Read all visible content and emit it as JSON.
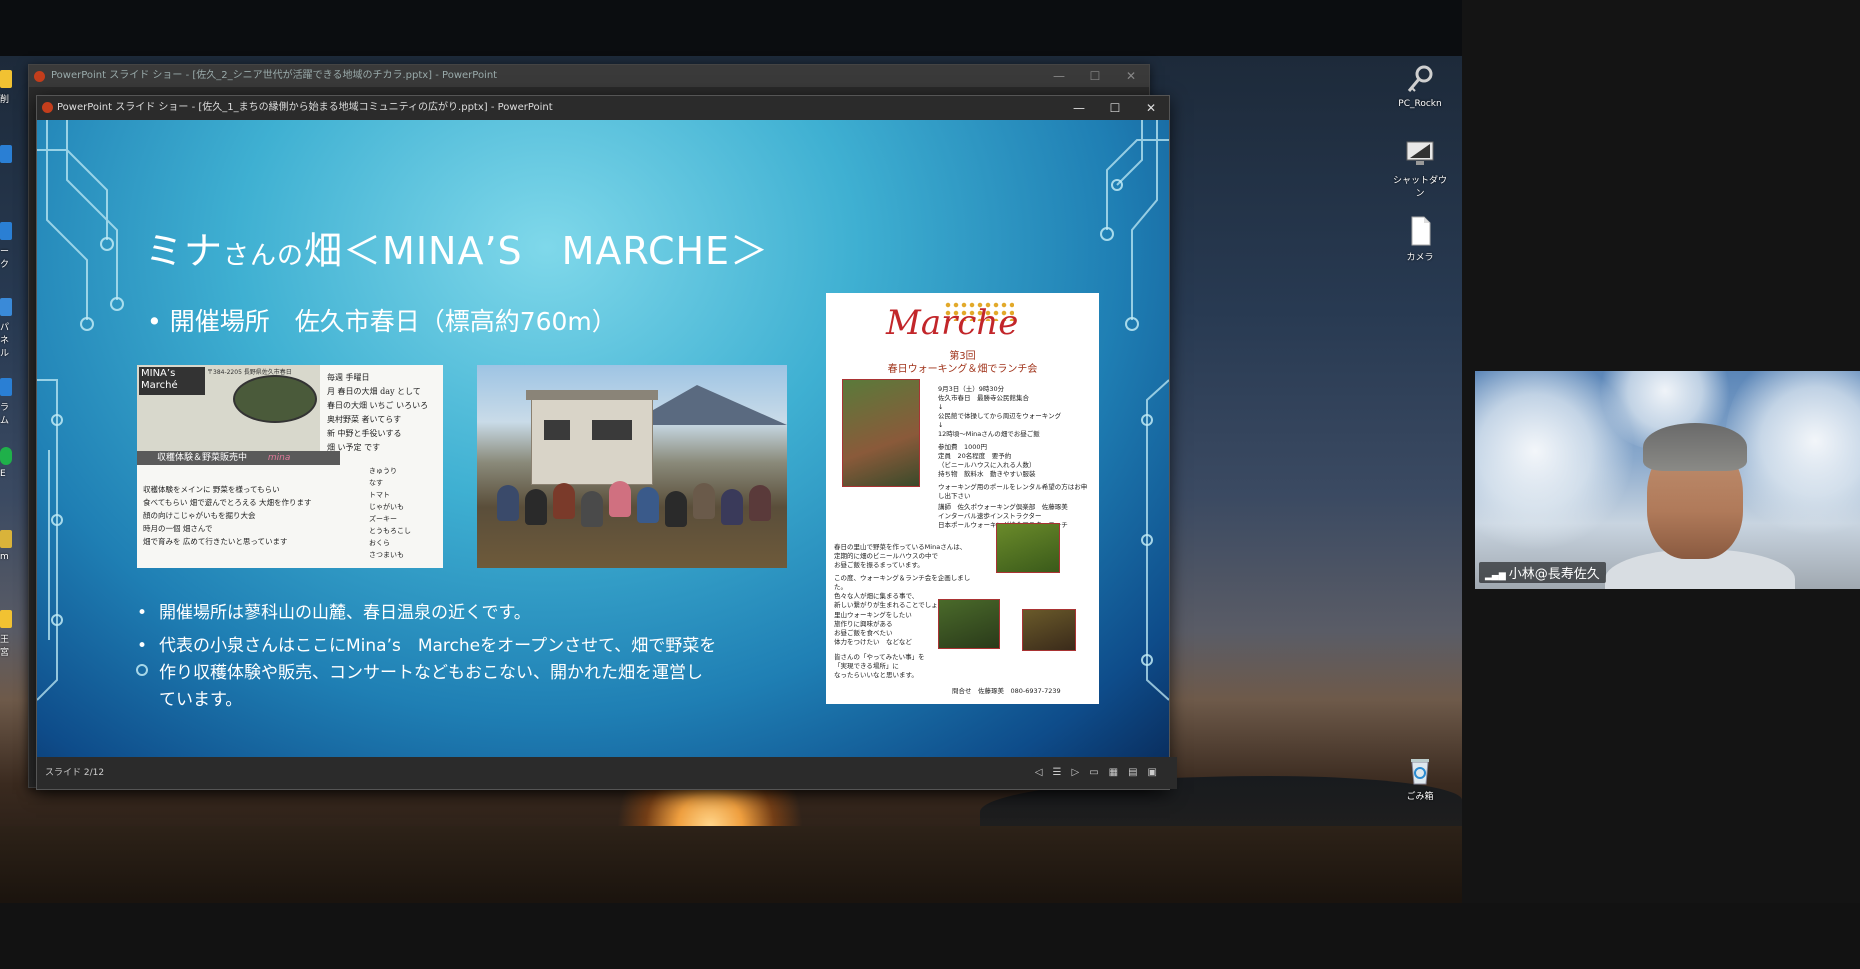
{
  "back_window": {
    "title": "PowerPoint スライド ショー - [佐久_2_シニア世代が活躍できる地域のチカラ.pptx] - PowerPoint",
    "controls": [
      "—",
      "☐",
      "✕"
    ]
  },
  "front_window": {
    "title": "PowerPoint スライド ショー - [佐久_1_まちの縁側から始まる地域コミュニティの広がり.pptx] - PowerPoint",
    "controls": [
      "—",
      "☐",
      "✕"
    ]
  },
  "slide": {
    "title_part1": "ミナ",
    "title_part2": "さんの",
    "title_part3": "畑＜MINA’S　MARCHE＞",
    "subtitle": "• 開催場所　佐久市春日（標高約760m）",
    "bullets": [
      "開催場所は蓼科山の山麓、春日温泉の近くです。",
      "代表の小泉さんはここにMina’s　Marcheをオープンさせて、畑で野菜を作り収穫体験や販売、コンサートなどもおこない、開かれた畑を運営しています。"
    ],
    "photo1": {
      "logo": "MINA’s Marché",
      "address": "〒384-2205 長野県佐久市春日",
      "bar_label": "収穫体験＆野菜販売中",
      "signature": "mina",
      "hand_notes": [
        "毎週 手曜日",
        "月 春日の大畑 day として",
        "春日の大畑 いちご いろいろ",
        "奥村野菜 者いてらす",
        "新 中野と手役いする",
        "畑 い予定 です"
      ],
      "veg_list": [
        "きゅうり",
        "なす",
        "トマト",
        "じゃがいも",
        "ズーキー",
        "とうもろこし",
        "おくら",
        "さつまいも"
      ],
      "bottom_note": [
        "収穫体験をメインに 野菜を様ってもらい",
        "食べてもらい 畑で遊んでとろえる 大畑を作ります",
        "顔の向けこじゃがいもを掘り大会",
        "時月の一個 畑さんで",
        "畑で育みを 広めて行きたいと思っています"
      ]
    },
    "flyer": {
      "logo": "Marche",
      "heading1": "第3回",
      "heading2": "春日ウォーキング＆畑でランチ会",
      "schedule": [
        "9月3日（土）9時30分",
        "佐久市春日　最勝寺公民館集合",
        "↓",
        "公民館で体操してから周辺をウォーキング",
        "↓",
        "12時頃～Minaさんの畑でお昼ご飯"
      ],
      "fees": [
        "参加費　1000円",
        "定員　20名程度　要予約",
        "（ビニールハウスに入れる人数）",
        "持ち物　飲料水　動きやすい服装"
      ],
      "note1": "ウォーキング用のポールをレンタル希望の方はお申し出下さい",
      "lecturer": [
        "講師　佐久ポウォーキング倶楽部　佐藤琢美",
        "インターバル速歩インストラクター",
        "日本ポールウォーキング協会マスターコーチ"
      ],
      "story": [
        "春日の里山で野菜を作っているMinaさんは、",
        "定期的に畑のビニールハウスの中で",
        "お昼ご飯を振るまっています。",
        "この度、ウォーキング＆ランチ会を企画しました。",
        "色々な人が畑に集まる事で、",
        "新しい繋がりが生まれることでしょう。"
      ],
      "wishes": [
        "里山ウォーキングをしたい",
        "旅作りに興味がある",
        "お昼ご飯を食べたい",
        "体力をつけたい　などなど"
      ],
      "closing": [
        "皆さんの「やってみたい事」を",
        "「実現できる場所」に",
        "なったらいいなと思います。"
      ],
      "contact": "問合せ　佐藤琢美　080-6937-7239"
    },
    "status": "スライド 2/12"
  },
  "desktop_icons": [
    {
      "label": "PC_Rockn",
      "icon": "key-icon"
    },
    {
      "label": "シャットダウン",
      "icon": "shutdown-icon"
    },
    {
      "label": "カメラ",
      "icon": "file-icon"
    },
    {
      "label": "ごみ箱",
      "icon": "recycle-bin-icon"
    }
  ],
  "left_icons": [
    "削",
    "",
    "ーク",
    "パネル",
    "ラム",
    "E",
    "m",
    "王宮"
  ],
  "video": {
    "participant_name": "小林@長寿佐久"
  },
  "colors": {
    "slide_accent": "#3fb0d2",
    "ppt_brand": "#c43e1c",
    "flyer_red": "#c2262a"
  }
}
